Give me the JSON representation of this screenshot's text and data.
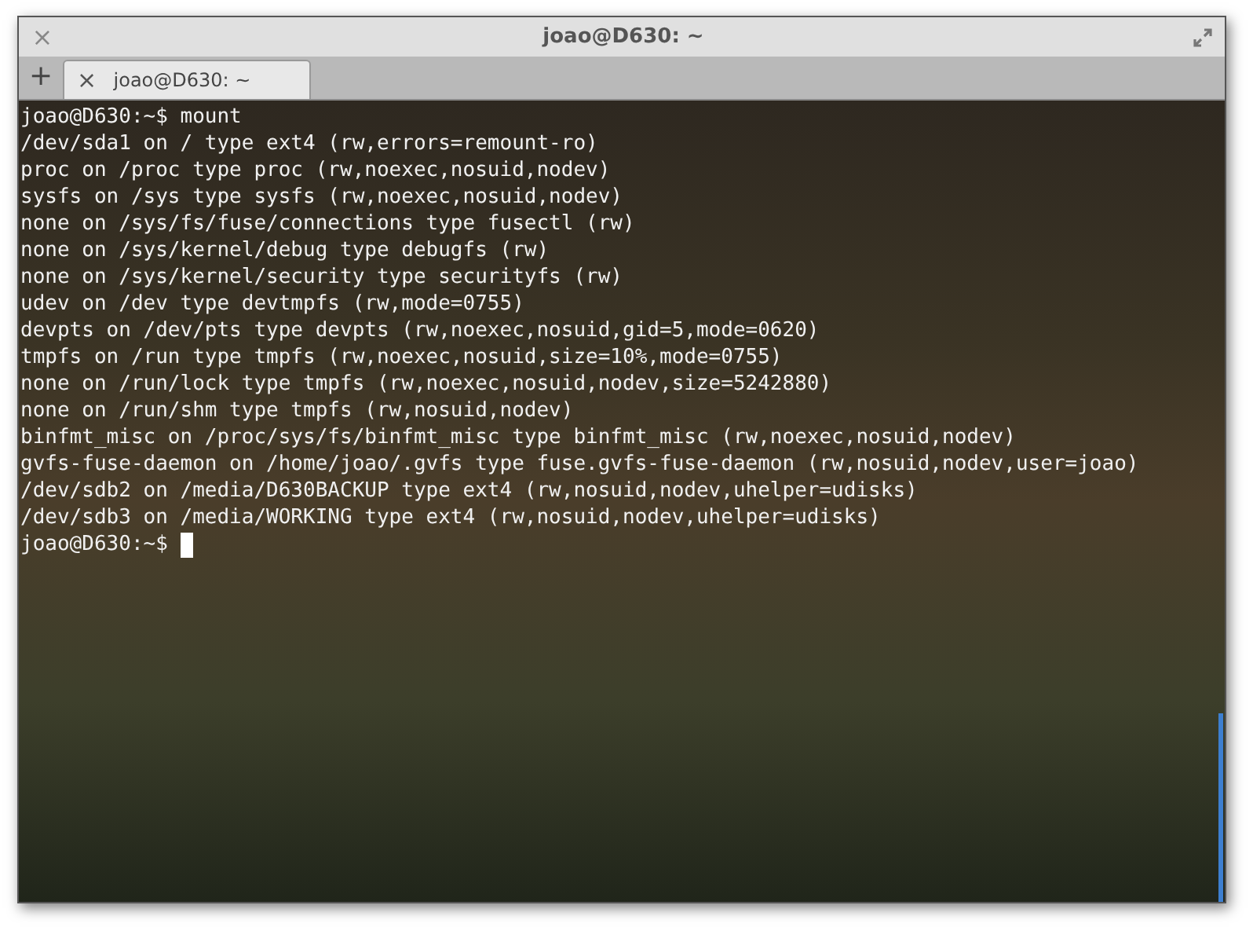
{
  "window": {
    "title": "joao@D630: ~",
    "close_glyph": "×",
    "new_tab_glyph": "+"
  },
  "tabs": [
    {
      "label": "joao@D630: ~",
      "close_glyph": "×",
      "selected": true
    }
  ],
  "terminal": {
    "lines": [
      "joao@D630:~$ mount",
      "/dev/sda1 on / type ext4 (rw,errors=remount-ro)",
      "proc on /proc type proc (rw,noexec,nosuid,nodev)",
      "sysfs on /sys type sysfs (rw,noexec,nosuid,nodev)",
      "none on /sys/fs/fuse/connections type fusectl (rw)",
      "none on /sys/kernel/debug type debugfs (rw)",
      "none on /sys/kernel/security type securityfs (rw)",
      "udev on /dev type devtmpfs (rw,mode=0755)",
      "devpts on /dev/pts type devpts (rw,noexec,nosuid,gid=5,mode=0620)",
      "tmpfs on /run type tmpfs (rw,noexec,nosuid,size=10%,mode=0755)",
      "none on /run/lock type tmpfs (rw,noexec,nosuid,nodev,size=5242880)",
      "none on /run/shm type tmpfs (rw,nosuid,nodev)",
      "binfmt_misc on /proc/sys/fs/binfmt_misc type binfmt_misc (rw,noexec,nosuid,nodev)",
      "gvfs-fuse-daemon on /home/joao/.gvfs type fuse.gvfs-fuse-daemon (rw,nosuid,nodev,user=joao)",
      "/dev/sdb2 on /media/D630BACKUP type ext4 (rw,nosuid,nodev,uhelper=udisks)",
      "/dev/sdb3 on /media/WORKING type ext4 (rw,nosuid,nodev,uhelper=udisks)"
    ],
    "prompt": "joao@D630:~$"
  }
}
